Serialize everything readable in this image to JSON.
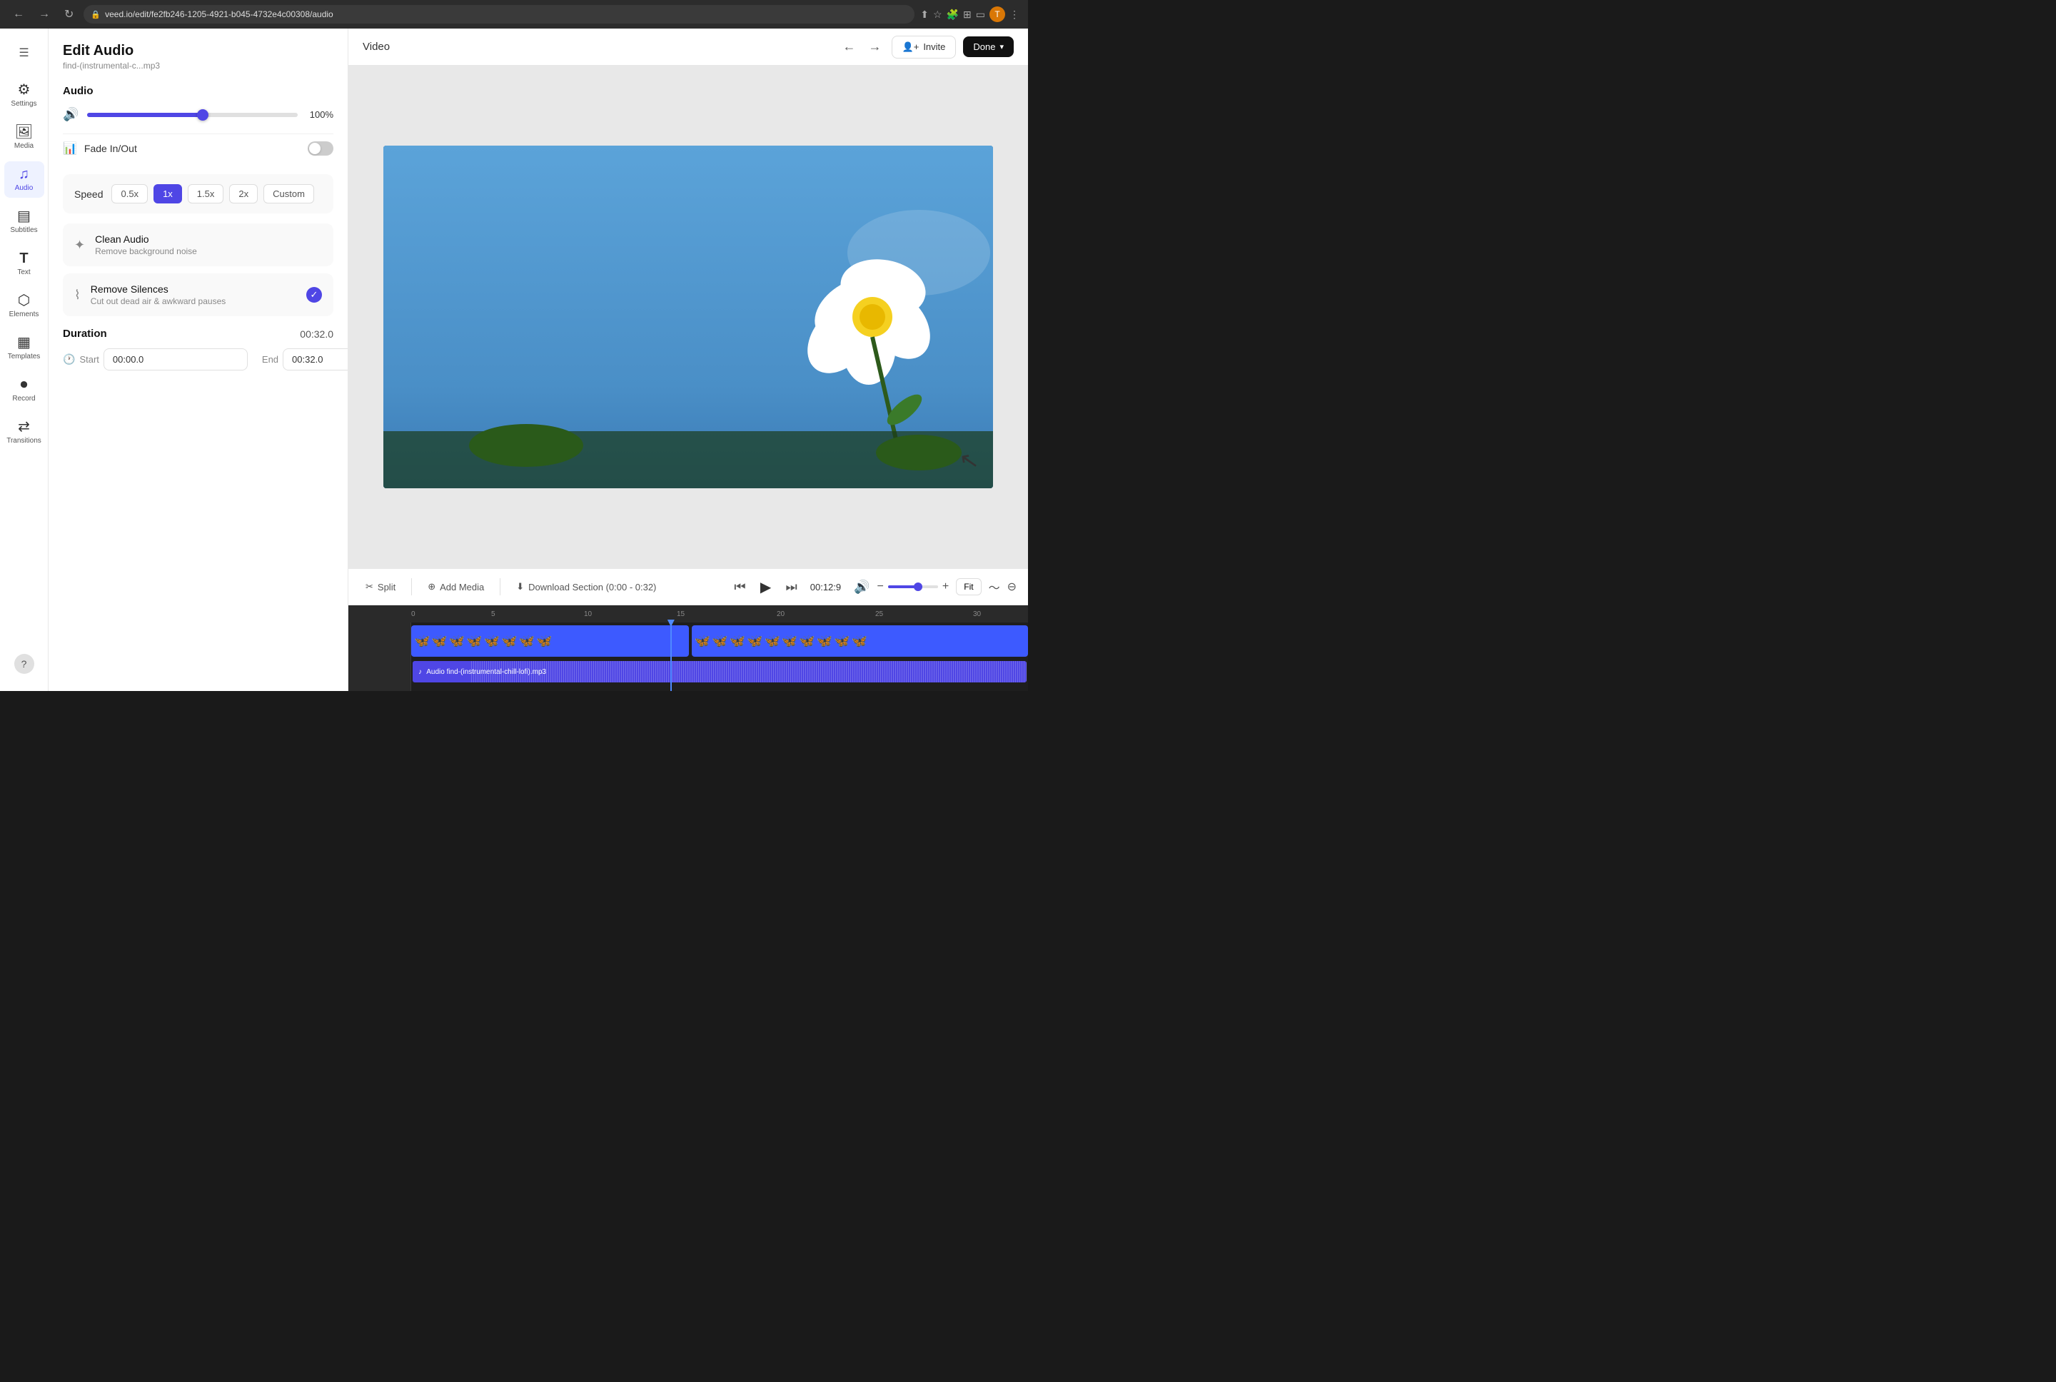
{
  "browser": {
    "url": "veed.io/edit/fe2fb246-1205-4921-b045-4732e4c00308/audio",
    "url_full": "veed.io/edit/fe2fb246-1205-4921-b045-4732e4c00308/audio"
  },
  "sidebar": {
    "items": [
      {
        "id": "settings",
        "label": "Settings",
        "icon": "⚙",
        "active": false
      },
      {
        "id": "media",
        "label": "Media",
        "icon": "🖼",
        "active": false
      },
      {
        "id": "audio",
        "label": "Audio",
        "icon": "🎵",
        "active": true
      },
      {
        "id": "subtitles",
        "label": "Subtitles",
        "icon": "💬",
        "active": false
      },
      {
        "id": "text",
        "label": "Text",
        "icon": "T",
        "active": false
      },
      {
        "id": "elements",
        "label": "Elements",
        "icon": "⬡",
        "active": false
      },
      {
        "id": "templates",
        "label": "Templates",
        "icon": "▦",
        "active": false
      },
      {
        "id": "record",
        "label": "Record",
        "icon": "⏺",
        "active": false
      },
      {
        "id": "transitions",
        "label": "Transitions",
        "icon": "⟷",
        "active": false
      }
    ]
  },
  "edit_panel": {
    "title": "Edit Audio",
    "subtitle": "find-(instrumental-c...mp3",
    "audio_section": "Audio",
    "volume_pct": "100%",
    "fade_label": "Fade In/Out",
    "speed_label": "Speed",
    "speed_options": [
      "0.5x",
      "1x",
      "1.5x",
      "2x",
      "Custom"
    ],
    "speed_active": "1x",
    "clean_audio_title": "Clean Audio",
    "clean_audio_desc": "Remove background noise",
    "remove_silences_title": "Remove Silences",
    "remove_silences_desc": "Cut out dead air & awkward pauses",
    "duration_label": "Duration",
    "duration_value": "00:32.0",
    "start_label": "Start",
    "start_value": "00:00.0",
    "end_label": "End",
    "end_value": "00:32.0"
  },
  "topbar": {
    "title": "Video",
    "invite_label": "Invite",
    "done_label": "Done"
  },
  "timeline": {
    "split_label": "Split",
    "add_media_label": "Add Media",
    "download_label": "Download Section (0:00 - 0:32)",
    "current_time": "00:12:9",
    "fit_label": "Fit",
    "ruler_marks": [
      "0",
      "5",
      "10",
      "15",
      "20",
      "25",
      "30"
    ],
    "audio_track_label": "Audio find-(instrumental-chill-lofi).mp3"
  }
}
